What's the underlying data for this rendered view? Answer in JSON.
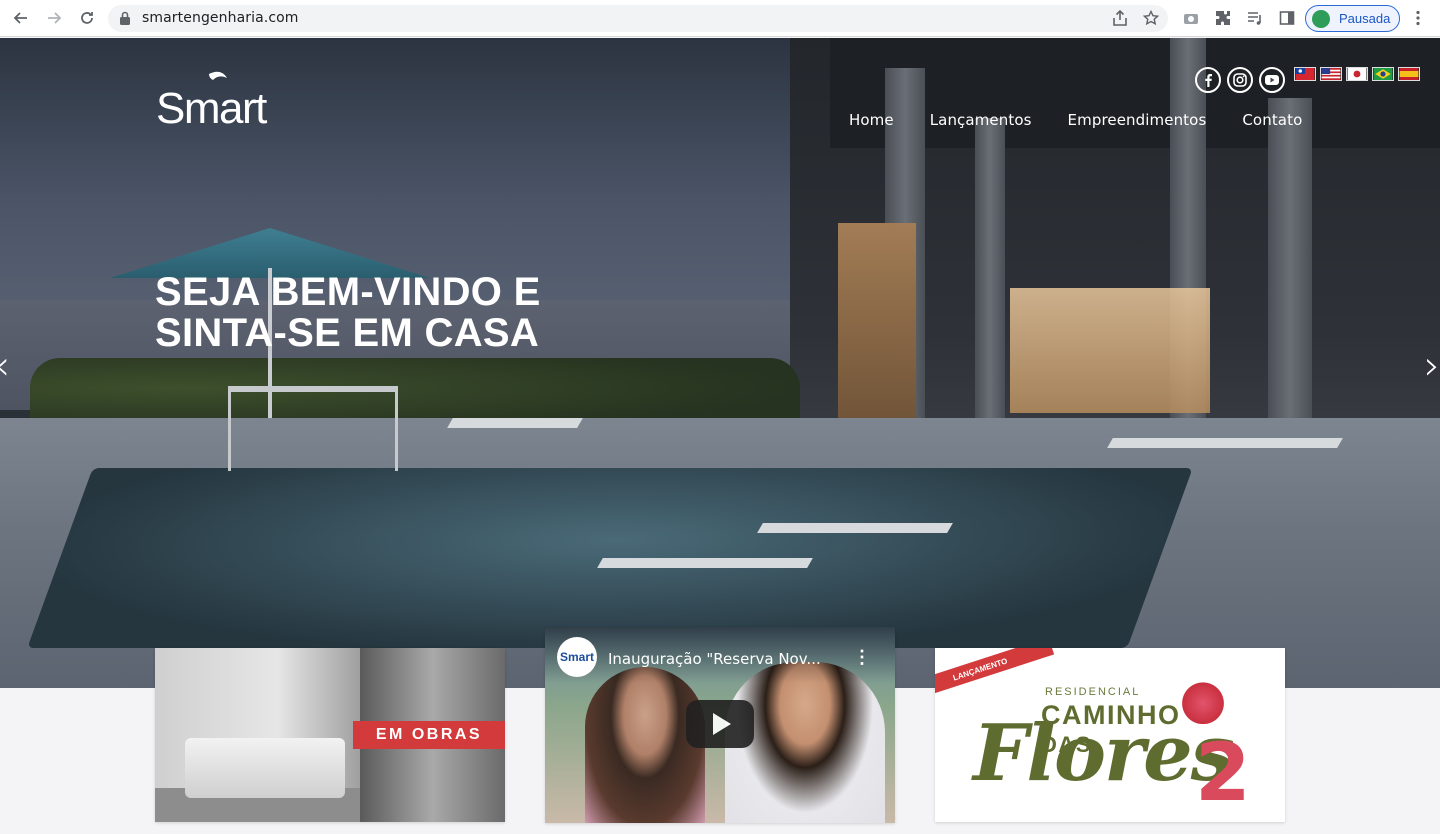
{
  "browser": {
    "url": "smartengenharia.com",
    "profile_label": "Pausada"
  },
  "site": {
    "logo_text": "Smart",
    "nav": [
      "Home",
      "Lançamentos",
      "Empreendimentos",
      "Contato"
    ],
    "hero_title_line1": "SEJA BEM-VINDO E",
    "hero_title_line2": "SINTA-SE EM CASA",
    "social_icons": [
      "facebook-icon",
      "instagram-icon",
      "youtube-icon"
    ],
    "flags": [
      "taiwan-flag-icon",
      "usa-flag-icon",
      "japan-flag-icon",
      "brazil-flag-icon",
      "spain-flag-icon"
    ],
    "arrow_left": "‹",
    "arrow_right": "›"
  },
  "cards": {
    "obras_label": "EM OBRAS",
    "video_channel": "Smart",
    "video_title": "Inauguração \"Reserva Nov...",
    "launch_tag": "LANÇAMENTO",
    "residencial": "RESIDENCIAL",
    "caminho": "CAMINHO",
    "das": "DAS",
    "flores": "Flores",
    "number": "2"
  },
  "colors": {
    "accent_red": "#d33a3c",
    "brand_green": "#5f6c2f",
    "profile_blue": "#1a56c5"
  }
}
